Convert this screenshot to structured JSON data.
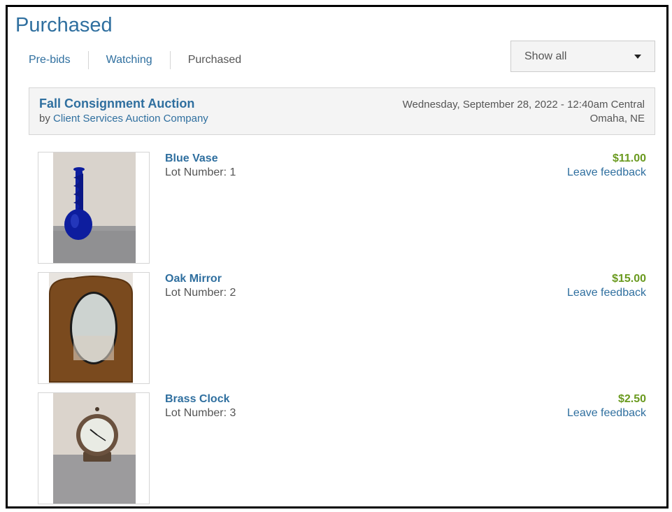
{
  "page": {
    "title": "Purchased"
  },
  "tabs": [
    {
      "label": "Pre-bids"
    },
    {
      "label": "Watching"
    },
    {
      "label": "Purchased"
    }
  ],
  "filter": {
    "selected": "Show all",
    "icon": "caret-down-icon"
  },
  "auction": {
    "name": "Fall Consignment Auction",
    "by_prefix": "by",
    "company": "Client Services Auction Company",
    "datetime": "Wednesday, September 28, 2022 - 12:40am Central",
    "location": "Omaha, NE"
  },
  "lots": [
    {
      "name": "Blue Vase",
      "lot_number": "Lot Number: 1",
      "price": "$11.00",
      "feedback": "Leave feedback"
    },
    {
      "name": "Oak Mirror",
      "lot_number": "Lot Number: 2",
      "price": "$15.00",
      "feedback": "Leave feedback"
    },
    {
      "name": "Brass Clock",
      "lot_number": "Lot Number: 3",
      "price": "$2.50",
      "feedback": "Leave feedback"
    }
  ],
  "colors": {
    "link": "#2f6f9f",
    "price": "#6a9a1f",
    "panel": "#f4f4f4"
  }
}
